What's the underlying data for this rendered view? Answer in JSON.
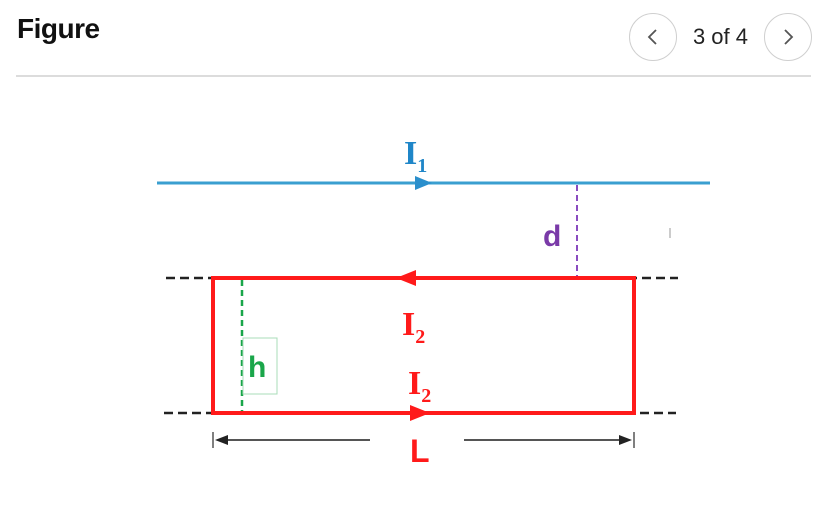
{
  "header": {
    "title": "Figure",
    "pager": {
      "current": 3,
      "total": 4,
      "label": "3 of 4",
      "prev_icon": "chevron-left-icon",
      "next_icon": "chevron-right-icon"
    }
  },
  "diagram": {
    "wire": {
      "label_main": "I",
      "label_sub": "1",
      "color": "#3a9fd0",
      "direction": "right"
    },
    "loop": {
      "color": "#ff1a1a",
      "top_current": {
        "label_main": "I",
        "label_sub": "2",
        "direction": "left"
      },
      "bottom_current": {
        "label_main": "I",
        "label_sub": "2",
        "direction": "right"
      }
    },
    "distance_label": {
      "text": "d",
      "color": "#7a3aa8"
    },
    "height_label": {
      "text": "h",
      "color": "#1aa64a"
    },
    "length_label": {
      "text": "L",
      "color": "#ff1a1a"
    }
  }
}
